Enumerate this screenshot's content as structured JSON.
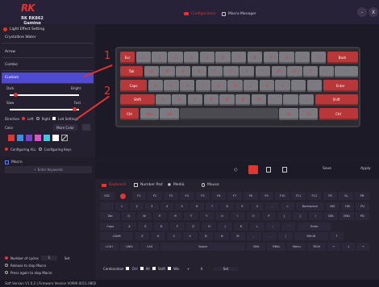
{
  "header": {
    "brand": "RK",
    "brand_sub": "RK RK862 Gaming",
    "tab_configuration": "Configuration",
    "tab_macro_manager": "Macro Manager",
    "min_label": "-",
    "close_label": "X"
  },
  "sidebar": {
    "title": "Light Effect Setting",
    "effects": [
      "Crystalline Water",
      "Arrow",
      "Combo",
      "Custom"
    ],
    "selected_effect": "Custom",
    "dark_label": "Dark",
    "bright_label": "Bright",
    "slow_label": "Slow",
    "fast_label": "Fast",
    "direction_label": "Direction",
    "left_label": "Left",
    "right_label": "Right",
    "led_settings_label": "Led Settings",
    "color_label": "Color",
    "more_color_label": "More Color",
    "swatches": [
      "#e3342f",
      "#3b8ede",
      "#7b3fd0",
      "#e54ec9",
      "#3ec8e0",
      "#ffffff"
    ],
    "configuring_all_label": "Configuring ALL",
    "configuring_keys_label": "Configuring Keys"
  },
  "macro_panel": {
    "title": "Macro",
    "search_placeholder": "Enter Keywords",
    "cycles_label": "Number of cycles",
    "cycles_value": "1",
    "set_label": "Set",
    "release_label": "Release to stop Macro",
    "press_label": "Press again to stop Macro"
  },
  "keyboard_image": {
    "callout_1": "1",
    "callout_2": "2",
    "row1": [
      "Esc",
      "1",
      "2",
      "3",
      "4",
      "5",
      "6",
      "7",
      "8",
      "9",
      "0",
      "-",
      "=",
      "Back"
    ],
    "row2": [
      "Tab",
      "Q",
      "W",
      "E",
      "R",
      "T",
      "Y",
      "U",
      "I",
      "O",
      "P",
      "[",
      "]",
      "\\"
    ],
    "row3": [
      "Caps",
      "A",
      "S",
      "D",
      "F",
      "G",
      "H",
      "J",
      "K",
      "L",
      ";",
      "'",
      "Enter"
    ],
    "row4": [
      "Shift",
      "Z",
      "X",
      "C",
      "V",
      "B",
      "N",
      "M",
      ",",
      ".",
      "/",
      "Shift"
    ],
    "row5": [
      "Ctrl",
      "Win",
      "Alt",
      "",
      "Alt",
      "Fn",
      "Ctrl"
    ]
  },
  "toolbar": {
    "save_label": "Save",
    "apply_label": "Apply"
  },
  "keymap": {
    "tabs": [
      "Keyboard",
      "Number Pad",
      "Media",
      "Mouse"
    ],
    "rows": [
      [
        "ESC",
        "",
        "F1",
        "F2",
        "F3",
        "F4",
        "F5",
        "F6",
        "F7",
        "F8",
        "F9",
        "F10",
        "F11",
        "F12",
        "PS",
        "SL",
        "PB"
      ],
      [
        "`",
        "1",
        "2",
        "3",
        "4",
        "5",
        "6",
        "7",
        "8",
        "9",
        "0",
        "-",
        "=",
        "Backspace",
        "INS",
        "HM",
        "PU"
      ],
      [
        "Tab",
        "Q",
        "W",
        "E",
        "R",
        "T",
        "Y",
        "U",
        "I",
        "O",
        "P",
        "[",
        "]",
        "\\",
        "DEL",
        "END",
        "PD"
      ],
      [
        "Caps",
        "A",
        "S",
        "D",
        "F",
        "G",
        "H",
        "J",
        "K",
        "L",
        ";",
        "'",
        "Enter"
      ],
      [
        "LShift",
        "Z",
        "X",
        "C",
        "V",
        "B",
        "N",
        "M",
        ",",
        ".",
        "/",
        "RShift",
        "↑"
      ],
      [
        "LCtrl",
        "LWin",
        "LAlt",
        "Space",
        "RAlt",
        "RWin",
        "Menu",
        "RCtrl",
        "←",
        "↓",
        "→"
      ]
    ],
    "combination_label": "Combination",
    "ctrl_label": "Ctrl",
    "alt_label": "Alt",
    "shift_label": "Shift",
    "win_label": "Win",
    "plus_label": "+",
    "key_value": "A",
    "set_label": "Set"
  },
  "status": {
    "text": "Soft Version V1.0.2 | Firmware Version V0990.0011.0802"
  },
  "colors": {
    "accent": "#e3342f",
    "selected": "#4e4bcf",
    "background": "#1e1b2b"
  }
}
